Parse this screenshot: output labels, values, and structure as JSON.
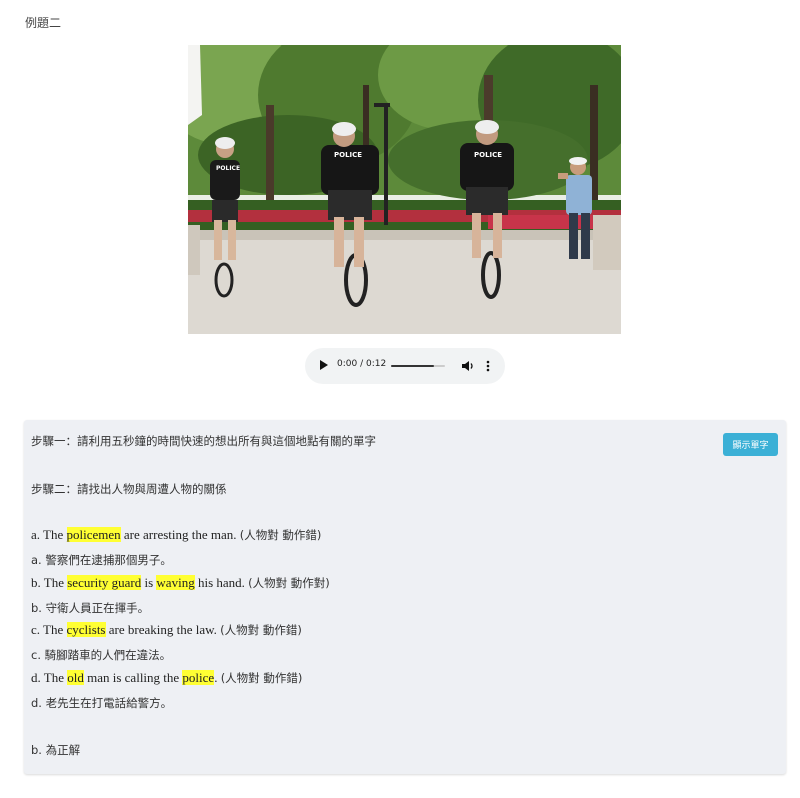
{
  "page": {
    "title": "例題二"
  },
  "photo": {
    "alt": "Three bicycle police officers riding away toward a man in a blue shirt and cap in a park plaza",
    "jersey_text": "POLICE"
  },
  "audio": {
    "time": "0:00 / 0:12",
    "progress": 0.8
  },
  "panel": {
    "button_label": "顯示單字",
    "step1": "步驟一：請利用五秒鐘的時間快速的想出所有與這個地點有關的單字",
    "step2": "步驟二：請找出人物與周遭人物的關係",
    "a": {
      "p1": "a. The ",
      "h1": "policemen",
      "p2": " are arresting the man. ",
      "note": "(人物對 動作錯)",
      "zh": "a. 警察們在逮捕那個男子。"
    },
    "b": {
      "p1": "b. The ",
      "h1": "security guard",
      "p2": " is ",
      "h2": "waving",
      "p3": " his hand. ",
      "note": "(人物對 動作對)",
      "zh": "b. 守衛人員正在揮手。"
    },
    "c": {
      "p1": "c. The ",
      "h1": "cyclists",
      "p2": " are breaking the law. ",
      "note": "(人物對 動作錯)",
      "zh": "c. 騎腳踏車的人們在違法。"
    },
    "d": {
      "p1": "d. The ",
      "h1": "old",
      "p2": " man is calling the ",
      "h2": "police",
      "p3": ". ",
      "note": "(人物對 動作錯)",
      "zh": "d. 老先生在打電話給警方。"
    },
    "answer": "b. 為正解"
  },
  "colors": {
    "highlight": "#ffff33",
    "button": "#3bb0d6",
    "panel_bg": "#eef0f4"
  },
  "icons": [
    "play-icon",
    "volume-icon",
    "more-options-icon"
  ]
}
